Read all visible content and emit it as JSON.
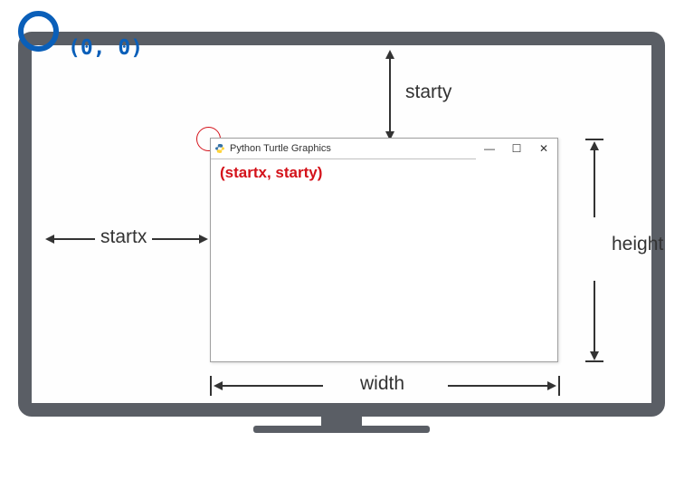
{
  "origin": {
    "label": "(0, 0)"
  },
  "window": {
    "title": "Python Turtle Graphics",
    "cornerLabel": "(startx, starty)"
  },
  "labels": {
    "startx": "startx",
    "starty": "starty",
    "width": "width",
    "height": "height"
  },
  "controls": {
    "minimize": "—",
    "maximize": "☐",
    "close": "✕"
  }
}
